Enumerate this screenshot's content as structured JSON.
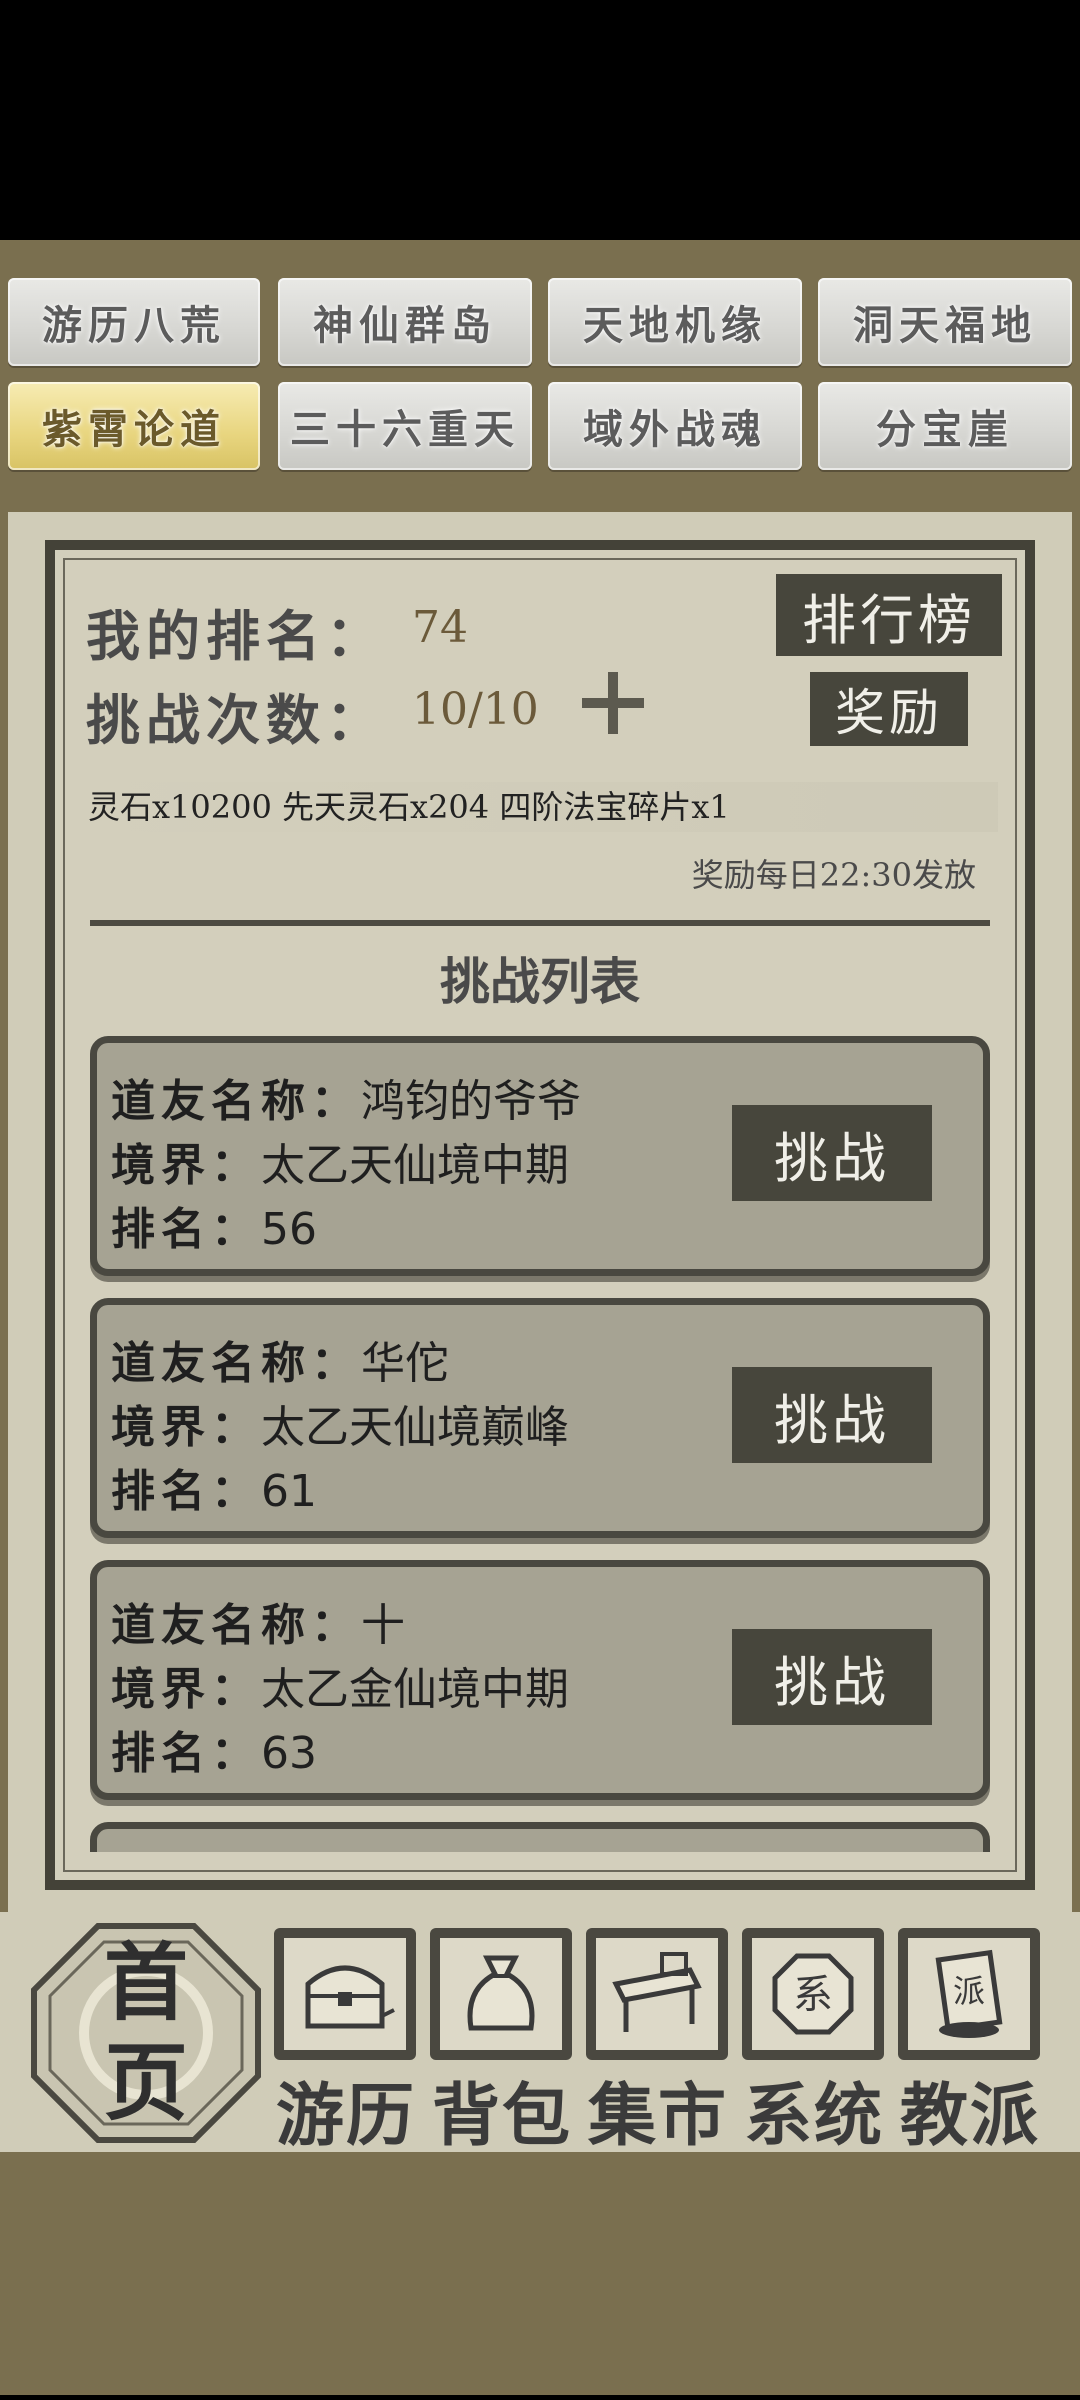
{
  "tabs": {
    "row1": [
      "游历八荒",
      "神仙群岛",
      "天地机缘",
      "洞天福地"
    ],
    "row2": [
      "紫霄论道",
      "三十六重天",
      "域外战魂",
      "分宝崖"
    ]
  },
  "ranking": {
    "my_rank_label": "我的排名：",
    "my_rank_value": "74",
    "challenge_count_label": "挑战次数：",
    "challenge_count_value": "10/10",
    "leaderboard_button": "排行榜",
    "reward_button": "奖励"
  },
  "reward": {
    "items": "灵石x10200 先天灵石x204 四阶法宝碎片x1",
    "schedule": "奖励每日22:30发放"
  },
  "challenge_list": {
    "title": "挑战列表",
    "name_label": "道友名称：",
    "realm_label": "境界：",
    "rank_label": "排名：",
    "button_label": "挑战",
    "entries": [
      {
        "name": "鸿钧的爷爷",
        "realm": "太乙天仙境中期",
        "rank": "56"
      },
      {
        "name": "华佗",
        "realm": "太乙天仙境巅峰",
        "rank": "61"
      },
      {
        "name": "十",
        "realm": "太乙金仙境中期",
        "rank": "63"
      }
    ]
  },
  "bottom_nav": {
    "home": [
      "首",
      "页"
    ],
    "items": [
      "游历",
      "背包",
      "集市",
      "系统",
      "教派"
    ],
    "icons": [
      "treasure-chest-icon",
      "bag-icon",
      "market-stall-icon",
      "system-seal-icon",
      "sect-scroll-icon"
    ]
  }
}
